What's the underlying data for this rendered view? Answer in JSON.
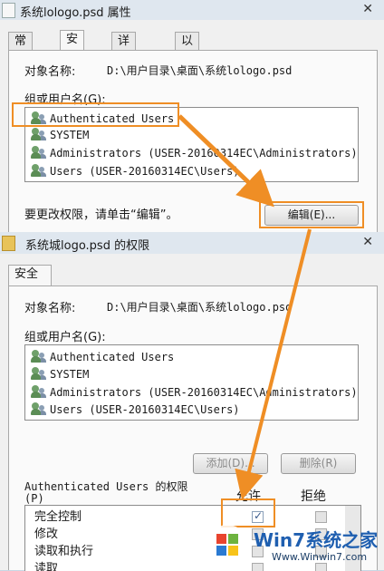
{
  "window1": {
    "title": "系统lologo.psd 属性",
    "close_glyph": "✕",
    "tabs": [
      "常规",
      "安全",
      "详细信息",
      "以前的版本"
    ],
    "object_name_label": "对象名称:",
    "object_name_value": "D:\\用户目录\\桌面\\系统lologo.psd",
    "group_label": "组或用户名(G):",
    "users": [
      "Authenticated Users",
      "SYSTEM",
      "Administrators (USER-20160314EC\\Administrators)",
      "Users (USER-20160314EC\\Users)"
    ],
    "hint": "要更改权限，请单击“编辑”。",
    "edit_button": "编辑(E)..."
  },
  "window2": {
    "title": "系统城logo.psd 的权限",
    "close_glyph": "✕",
    "tab": "安全",
    "object_name_label": "对象名称:",
    "object_name_value": "D:\\用户目录\\桌面\\系统lologo.psd",
    "group_label": "组或用户名(G):",
    "users": [
      "Authenticated Users",
      "SYSTEM",
      "Administrators (USER-20160314EC\\Administrators)",
      "Users (USER-20160314EC\\Users)"
    ],
    "add_button": "添加(D)...",
    "remove_button": "删除(R)",
    "perm_title": "Authenticated Users 的权限",
    "perm_title_suffix": "(P)",
    "allow_header": "允许",
    "deny_header": "拒绝",
    "permissions": [
      {
        "name": "完全控制",
        "allow": true,
        "deny": false
      },
      {
        "name": "修改",
        "allow": false,
        "deny": false
      },
      {
        "name": "读取和执行",
        "allow": false,
        "deny": false
      },
      {
        "name": "读取",
        "allow": false,
        "deny": false
      }
    ]
  },
  "watermark": {
    "brand": "Win7系统之家",
    "url": "Www.Winwin7.com"
  },
  "colors": {
    "highlight": "#ef8e25",
    "titlebar": "#dfe7ef"
  }
}
